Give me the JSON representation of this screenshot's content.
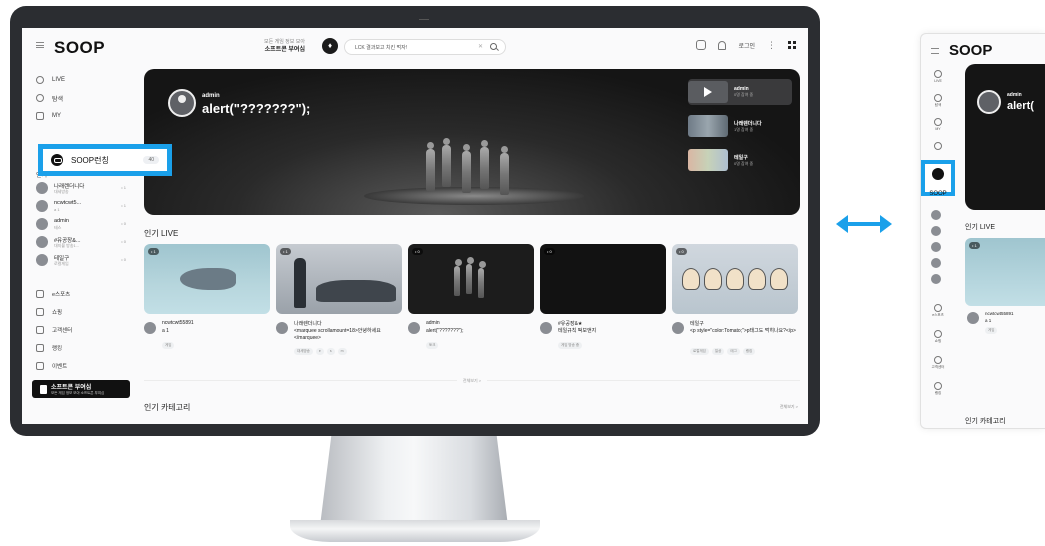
{
  "header": {
    "logo": "SOOP",
    "promo_line1": "모든 게임 정보 모아",
    "promo_line2": "소프트콘 부여심",
    "search_value": "LCK 결과보고 치킨 먹자!",
    "login": "로그인"
  },
  "sidebar": {
    "nav": [
      {
        "label": "LIVE",
        "icon": "broadcast-icon"
      },
      {
        "label": "탐색",
        "icon": "compass-icon"
      },
      {
        "label": "MY",
        "icon": "star-icon"
      }
    ],
    "soop_item": {
      "label": "SOOP런칭",
      "badge": "40"
    },
    "popular_title": "인기",
    "streamers": [
      {
        "name": "나래렌더니다",
        "sub": "대세방송",
        "viewers": "• 1"
      },
      {
        "name": "ncwtcwt5...",
        "sub": "a 1",
        "viewers": "• 1"
      },
      {
        "name": "admin",
        "sub": "테스",
        "viewers": "• 0"
      },
      {
        "name": "#유공장&...",
        "sub": "대지블 방송1...",
        "viewers": "• 0"
      },
      {
        "name": "테일구",
        "sub": "로컬게임",
        "viewers": "• 0"
      }
    ],
    "menu": [
      {
        "label": "e스포츠",
        "icon": "trophy-icon"
      },
      {
        "label": "쇼핑",
        "icon": "cart-icon"
      },
      {
        "label": "고객센터",
        "icon": "headset-icon"
      },
      {
        "label": "랭킹",
        "icon": "ranking-icon"
      },
      {
        "label": "이벤트",
        "icon": "calendar-icon"
      }
    ],
    "ad": {
      "title": "소프트콘 부여심",
      "sub": "모든 게임 정보 모아 소프트콘 부여심"
    }
  },
  "hero": {
    "channel": "admin",
    "title": "alert(\"???????\");",
    "side": [
      {
        "name": "admin",
        "sub": "0명 참여 중"
      },
      {
        "name": "나래렌더니다",
        "sub": "1명 참여 중"
      },
      {
        "name": "테일구",
        "sub": "0명 참여 중"
      }
    ]
  },
  "live": {
    "section_title": "인기 LIVE",
    "cards": [
      {
        "count": "• 1",
        "channel": "ncwtcwt55891",
        "title": "a 1",
        "tags": [
          "게임"
        ]
      },
      {
        "count": "• 1",
        "channel": "나래렌더니다",
        "title": "<marquee scrollamount=18>안녕하세요</marquee>",
        "tags": [
          "대세방송",
          "e",
          "s",
          "m"
        ]
      },
      {
        "count": "• 0",
        "channel": "admin",
        "title": "alert(\"???????\");",
        "tags": [
          "토크"
        ]
      },
      {
        "count": "• 0",
        "channel": "#유공장&★",
        "title": "테일규칙 떡보앤지",
        "tags": [
          "게임 방송 중"
        ]
      },
      {
        "count": "• 0",
        "channel": "테일구",
        "title": "<p style=\"color:Tomato;\">p태그도 먹히나요?</p>",
        "tags": [
          "로컬게임",
          "일상",
          "태그",
          "랭킹"
        ]
      }
    ],
    "more": "전체보기 >"
  },
  "category": {
    "title": "인기 카테고리",
    "more": "전체보기 >"
  },
  "right_view": {
    "logo": "SOOP",
    "rail": [
      "LIVE",
      "탐색",
      "MY"
    ],
    "soop_label": "SOOP",
    "hero_channel": "admin",
    "hero_title": "alert(",
    "section_title": "인기 LIVE",
    "card_count": "• 1",
    "card_channel": "ncwtcwt55891",
    "card_title": "a 1",
    "card_tag": "게임",
    "rail_menu": [
      "e스포츠",
      "쇼핑",
      "고객센터",
      "랭킹"
    ],
    "category_title": "인기 카테고리"
  },
  "colors": {
    "accent": "#1aa0ea",
    "hero_bg": "#151515",
    "monitor": "#2b2d31"
  }
}
